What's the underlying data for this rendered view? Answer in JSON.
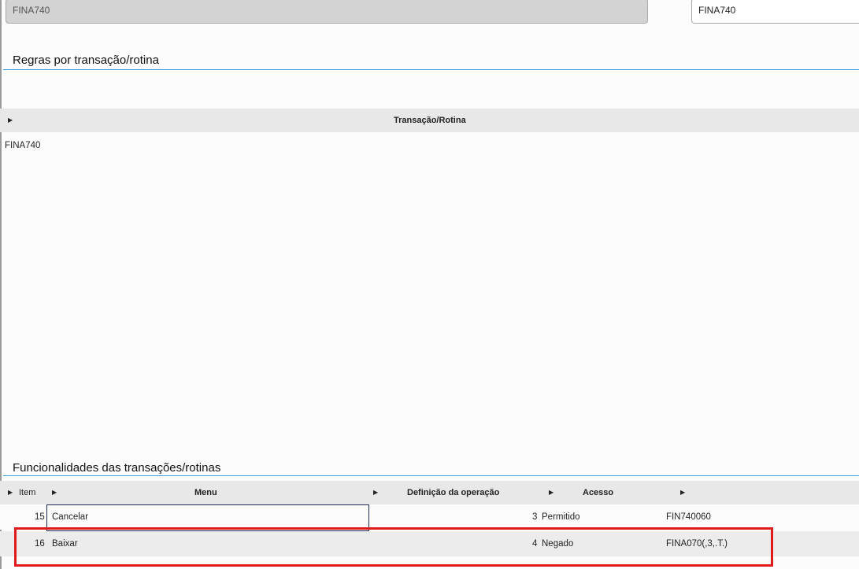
{
  "top_fields": {
    "routine_readonly": "FINA740",
    "routine_code": "FINA740"
  },
  "rules_section": {
    "title": "Regras por transação/rotina",
    "header": "Transação/Rotina",
    "rows": [
      {
        "value": "FINA740"
      }
    ]
  },
  "functions_section": {
    "title": "Funcionalidades das transações/rotinas",
    "headers": {
      "item": "Item",
      "menu": "Menu",
      "definition": "Definição da operação",
      "access": "Acesso"
    },
    "rows": [
      {
        "item": "15",
        "menu": "Cancelar",
        "definition": "3",
        "access": "Permitido",
        "function": "FIN740060"
      },
      {
        "item": "16",
        "menu": "Baixar",
        "definition": "4",
        "access": "Negado",
        "function": "FINA070(,3,.T.)"
      }
    ]
  },
  "colors": {
    "accent_line": "#3aa0e0",
    "highlight": "#e01b1b",
    "focus": "#1e2a5a"
  }
}
